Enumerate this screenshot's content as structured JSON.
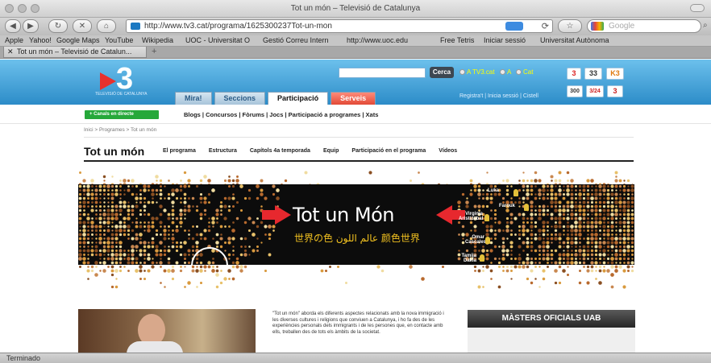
{
  "browser": {
    "window_title": "Tot un món – Televisió de Catalunya",
    "url": "http://www.tv3.cat/programa/1625300237Tot-un-mon",
    "search_placeholder": "Google",
    "bookmarks": [
      "Apple",
      "Yahoo!",
      "Google Maps",
      "YouTube",
      "Wikipedia",
      "UOC - Universitat O",
      "Gestió Correu Intern",
      "http://www.uoc.edu",
      "Free Tetris",
      "Iniciar sessió",
      "Universitat Autònoma"
    ],
    "tab_title": "Tot un món – Televisió de Catalun...",
    "new_tab": "+",
    "status": "Terminado"
  },
  "site": {
    "logo_text": "3",
    "logo_subtitle": "TELEVISIÓ DE CATALUNYA",
    "search_button": "Cerca",
    "radio_options": [
      "A TV3.cat",
      "A",
      "Cat"
    ],
    "nav_tabs": [
      "Mira!",
      "Seccions",
      "Participació",
      "Serveis"
    ],
    "header_links": "Registra't | Inicia sessió | Cistell",
    "channels": [
      "3",
      "33",
      "K3",
      "300",
      "3/24",
      "3"
    ],
    "live_button": "+ Canals en directe",
    "sub_links": "Blogs | Concursos | Fòrums | Jocs | Participació a programes | Xats",
    "breadcrumb": "Inici  >  Programes  >  Tot un món",
    "page_title": "Tot un món",
    "program_menu": [
      "El programa",
      "Estructura",
      "Capítols 4a temporada",
      "Equip",
      "Participació en el programa",
      "Vídeos"
    ],
    "banner": {
      "title": "Tot un Món",
      "subtitle": "世界の色  عالم اللون  颜色世界",
      "people": [
        "Luka",
        "Farouk",
        "Virginia Aristizábal",
        "Omar Cascales",
        "Tamija Dakla"
      ]
    },
    "description": "\"Tot un món\" aborda els diferents aspectes relacionats amb la nova immigració i les diverses cultures i religions que conviuen a Catalunya, i ho fa des de les experiències personals dels immigrants i de les persones que, en contacte amb ells, treballen des de tots els àmbits de la societat.",
    "masters_title": "MÀSTERS OFICIALS UAB"
  }
}
